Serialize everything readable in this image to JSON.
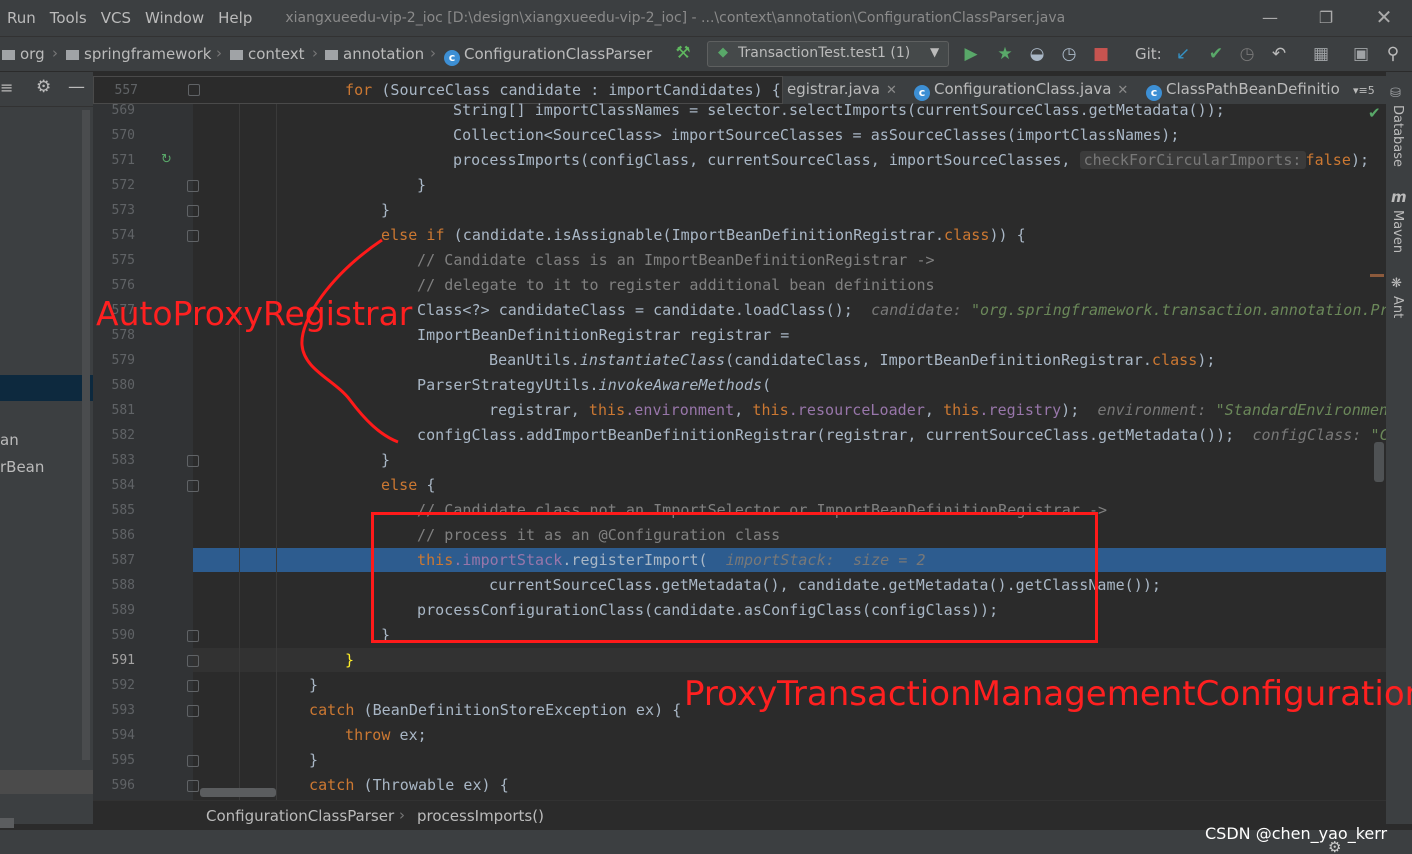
{
  "menu": {
    "items": [
      "Run",
      "Tools",
      "VCS",
      "Window",
      "Help"
    ],
    "window_title": "xiangxueedu-vip-2_ioc [D:\\design\\xiangxueedu-vip-2_ioc] - ...\\context\\annotation\\ConfigurationClassParser.java"
  },
  "breadcrumbs": [
    "org",
    "springframework",
    "context",
    "annotation",
    "ConfigurationClassParser"
  ],
  "run_config": "TransactionTest.test1 (1)",
  "git_label": "Git:",
  "tabs": [
    {
      "label": "egistrar.java"
    },
    {
      "label": "ConfigurationClass.java"
    },
    {
      "label": "ClassPathBeanDefinitio"
    }
  ],
  "tab_overflow": "5",
  "left_panel": {
    "items": [
      "an",
      "rBean"
    ]
  },
  "right_tools": [
    "Database",
    "Maven",
    "Ant"
  ],
  "sticky_line": {
    "number": "557",
    "code_kw": "for",
    "code_rest": " (SourceClass candidate : importCandidates) {"
  },
  "lines": {
    "569": {
      "num": "569",
      "code": "String[] importClassNames = selector.selectImports(currentSourceClass.getMetadata());"
    },
    "570": {
      "num": "570",
      "code": "Collection<SourceClass> importSourceClasses = asSourceClasses(importClassNames);"
    },
    "571": {
      "num": "571",
      "code": "processImports(configClass, currentSourceClass, importSourceClasses, ",
      "hint": "checkForCircularImports:",
      "kw": "false",
      "end": ");"
    },
    "572": {
      "num": "572",
      "code": "}"
    },
    "573": {
      "num": "573",
      "code": "}"
    },
    "574": {
      "num": "574",
      "kw1": "else if",
      "code": " (candidate.isAssignable(ImportBeanDefinitionRegistrar.",
      "kw2": "class",
      "end": ")) {"
    },
    "575": {
      "num": "575",
      "comment": "// Candidate class is an ImportBeanDefinitionRegistrar ->"
    },
    "576": {
      "num": "576",
      "comment": "// delegate to it to register additional bean definitions"
    },
    "577": {
      "num": "577",
      "code": "Class<?> candidateClass = candidate.loadClass();",
      "hint": "candidate:",
      "hintv": "\"org.springframework.transaction.annotation.Pro"
    },
    "578": {
      "num": "578",
      "code": "ImportBeanDefinitionRegistrar registrar ="
    },
    "579": {
      "num": "579",
      "code": "BeanUtils.",
      "it": "instantiateClass",
      "code2": "(candidateClass, ImportBeanDefinitionRegistrar.",
      "kw": "class",
      "end": ");"
    },
    "580": {
      "num": "580",
      "code": "ParserStrategyUtils.",
      "it": "invokeAwareMethods",
      "end": "("
    },
    "581": {
      "num": "581",
      "code": "registrar, ",
      "kw1": "this",
      "f1": ".environment",
      "c2": ", ",
      "kw2": "this",
      "f2": ".resourceLoader",
      "c3": ", ",
      "kw3": "this",
      "f3": ".registry",
      "end": ");",
      "hint": "environment:",
      "hintv": "\"StandardEnvironment"
    },
    "582": {
      "num": "582",
      "code": "configClass.addImportBeanDefinitionRegistrar(registrar, currentSourceClass.getMetadata());",
      "hint": "configClass:",
      "hintv": "\"Co"
    },
    "583": {
      "num": "583",
      "code": "}"
    },
    "584": {
      "num": "584",
      "kw": "else",
      "code": " {"
    },
    "585": {
      "num": "585",
      "comment": "// Candidate class not an ImportSelector or ImportBeanDefinitionRegistrar ->"
    },
    "586": {
      "num": "586",
      "comment": "// process it as an @Configuration class"
    },
    "587": {
      "num": "587",
      "kw": "this",
      "fld": ".importStack",
      "code": ".registerImport(",
      "hint": "importStack:",
      "hint2": "size = 2"
    },
    "588": {
      "num": "588",
      "code": "currentSourceClass.getMetadata(), candidate.getMetadata().getClassName());"
    },
    "589": {
      "num": "589",
      "code": "processConfigurationClass(candidate.asConfigClass(configClass));"
    },
    "590": {
      "num": "590",
      "code": "}"
    },
    "591": {
      "num": "591",
      "code": "}"
    },
    "592": {
      "num": "592",
      "code": "}"
    },
    "593": {
      "num": "593",
      "kw": "catch",
      "code": " (BeanDefinitionStoreException ex) {"
    },
    "594": {
      "num": "594",
      "kw": "throw",
      "code": " ex;"
    },
    "595": {
      "num": "595",
      "code": "}"
    },
    "596": {
      "num": "596",
      "kw": "catch",
      "code": " (Throwable ex) {"
    }
  },
  "bottom_breadcrumb": [
    "ConfigurationClassParser",
    "processImports()"
  ],
  "annotations": {
    "left_label": "AutoProxyRegistrar",
    "right_label": "ProxyTransactionManagementConfiguration",
    "color": "#ff1a1a"
  },
  "watermark": "CSDN @chen_yao_kerr"
}
